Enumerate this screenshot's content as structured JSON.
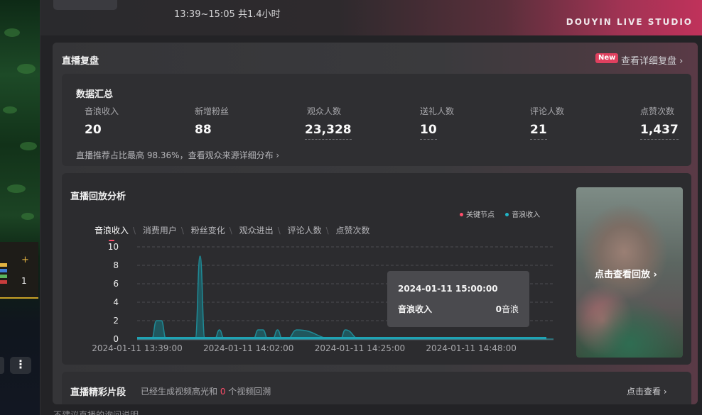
{
  "header": {
    "session_time": "13:39~15:05 共1.4小时",
    "studio_brand": "DOUYIN LIVE STUDIO"
  },
  "left_panel": {
    "thumb_plus": "+",
    "thumb_count": "1",
    "more_icon": "⋮"
  },
  "review": {
    "title": "直播复盘",
    "new_badge": "New",
    "detail_link": "查看详细复盘 ›"
  },
  "summary": {
    "title": "数据汇总",
    "stats": [
      {
        "label": "音浪收入",
        "value": "20"
      },
      {
        "label": "新增粉丝",
        "value": "88"
      },
      {
        "label": "观众人数",
        "value": "23,328"
      },
      {
        "label": "送礼人数",
        "value": "10"
      },
      {
        "label": "评论人数",
        "value": "21"
      },
      {
        "label": "点赞次数",
        "value": "1,437"
      }
    ],
    "note": "直播推荐占比最高 98.36%，查看观众来源详细分布 ›"
  },
  "analysis": {
    "title": "直播回放分析",
    "legend": {
      "key_node": "关键节点",
      "income": "音浪收入"
    },
    "tabs": [
      "音浪收入",
      "消费用户",
      "粉丝变化",
      "观众进出",
      "评论人数",
      "点赞次数"
    ],
    "active_tab": 0,
    "tooltip": {
      "time": "2024-01-11 15:00:00",
      "metric": "音浪收入",
      "value": "0",
      "unit": "音浪"
    },
    "replay_label": "点击查看回放 ›"
  },
  "highlights": {
    "title": "直播精彩片段",
    "desc_prefix": "已经生成视频高光和 ",
    "desc_count": "0",
    "desc_suffix": " 个视频回溯",
    "link": "点击查看 ›"
  },
  "footer_tip": "不建议直播的询问说明",
  "colors": {
    "accent": "#ff4d6a",
    "series": "#1f7f8c",
    "key_node": "#ff4d6a",
    "series_legend": "#21b5c6"
  },
  "chart_data": {
    "type": "area",
    "title": "",
    "xlabel": "",
    "ylabel": "",
    "ylim": [
      0,
      10
    ],
    "y_ticks": [
      0,
      2,
      4,
      6,
      8,
      10
    ],
    "x_ticks": [
      "2024-01-11 13:39:00",
      "2024-01-11 14:02:00",
      "2024-01-11 14:25:00",
      "2024-01-11 14:48:00"
    ],
    "series": [
      {
        "name": "音浪收入",
        "x": [
          "13:39",
          "13:41",
          "13:42",
          "13:43",
          "13:44",
          "13:45",
          "13:48",
          "13:50",
          "13:51",
          "13:52",
          "13:53",
          "13:55",
          "13:56",
          "13:57",
          "13:58",
          "13:59",
          "14:00",
          "14:02",
          "14:03",
          "14:04",
          "14:05",
          "14:06",
          "14:07",
          "14:08",
          "14:09",
          "14:10",
          "14:12",
          "14:20",
          "14:21",
          "14:22",
          "14:25",
          "14:48",
          "15:00",
          "15:05"
        ],
        "values": [
          0,
          0,
          0,
          2,
          2,
          0,
          0,
          0,
          0,
          9,
          0,
          0,
          1,
          0,
          0,
          0,
          0,
          0,
          0,
          1,
          1,
          0,
          0,
          1,
          0,
          0,
          1,
          0,
          0,
          1,
          0,
          0,
          0,
          0
        ]
      }
    ]
  }
}
